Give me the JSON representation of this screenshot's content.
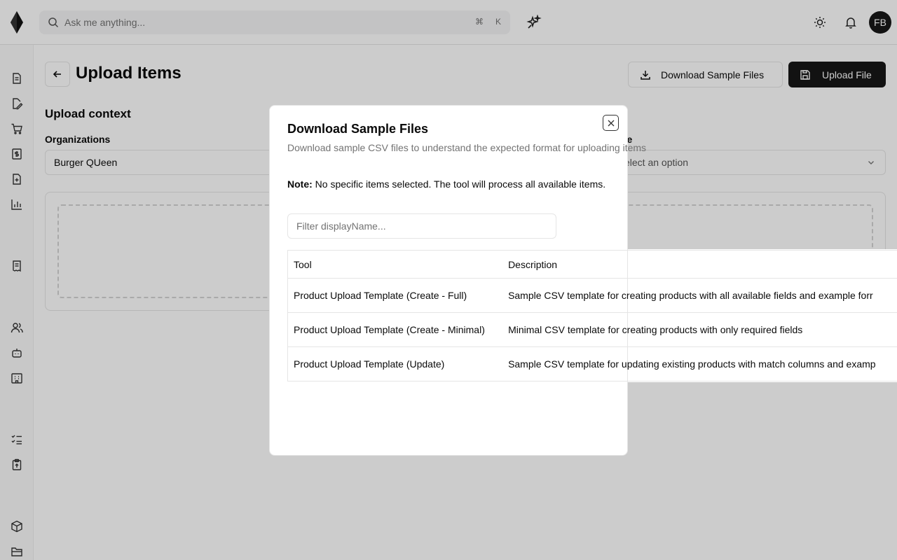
{
  "topbar": {
    "search_placeholder": "Ask me anything...",
    "shortcut_mod": "⌘",
    "shortcut_key": "K",
    "avatar_initials": "FB"
  },
  "sidebar": {
    "icons": [
      "file-text-icon",
      "file-edit-icon",
      "cart-icon",
      "dollar-doc-icon",
      "file-plus-icon",
      "bar-chart-icon",
      "receipt-icon",
      "users-icon",
      "bot-icon",
      "building-icon",
      "list-check-icon",
      "clipboard-upload-icon",
      "package-icon",
      "folder-icon"
    ]
  },
  "page": {
    "title": "Upload Items",
    "download_button": "Download Sample Files",
    "upload_button": "Upload File",
    "section_title": "Upload context",
    "org_label": "Organizations",
    "org_value": "Burger QUeen",
    "mode_label_partial": "de",
    "mode_placeholder_partial": "elect an option"
  },
  "dialog": {
    "title": "Download Sample Files",
    "description": "Download sample CSV files to understand the expected format for uploading items",
    "note_label": "Note:",
    "note_text": " No specific items selected. The tool will process all available items.",
    "filter_placeholder": "Filter displayName...",
    "table": {
      "headers": [
        "Tool",
        "Description"
      ],
      "rows": [
        {
          "tool": "Product Upload Template (Create - Full)",
          "description": "Sample CSV template for creating products with all available fields and example forr"
        },
        {
          "tool": "Product Upload Template (Create - Minimal)",
          "description": "Minimal CSV template for creating products with only required fields"
        },
        {
          "tool": "Product Upload Template (Update)",
          "description": "Sample CSV template for updating existing products with match columns and examp"
        }
      ]
    }
  },
  "colors": {
    "primary": "#171717",
    "border": "#e5e5e5",
    "muted_text": "#737373"
  }
}
